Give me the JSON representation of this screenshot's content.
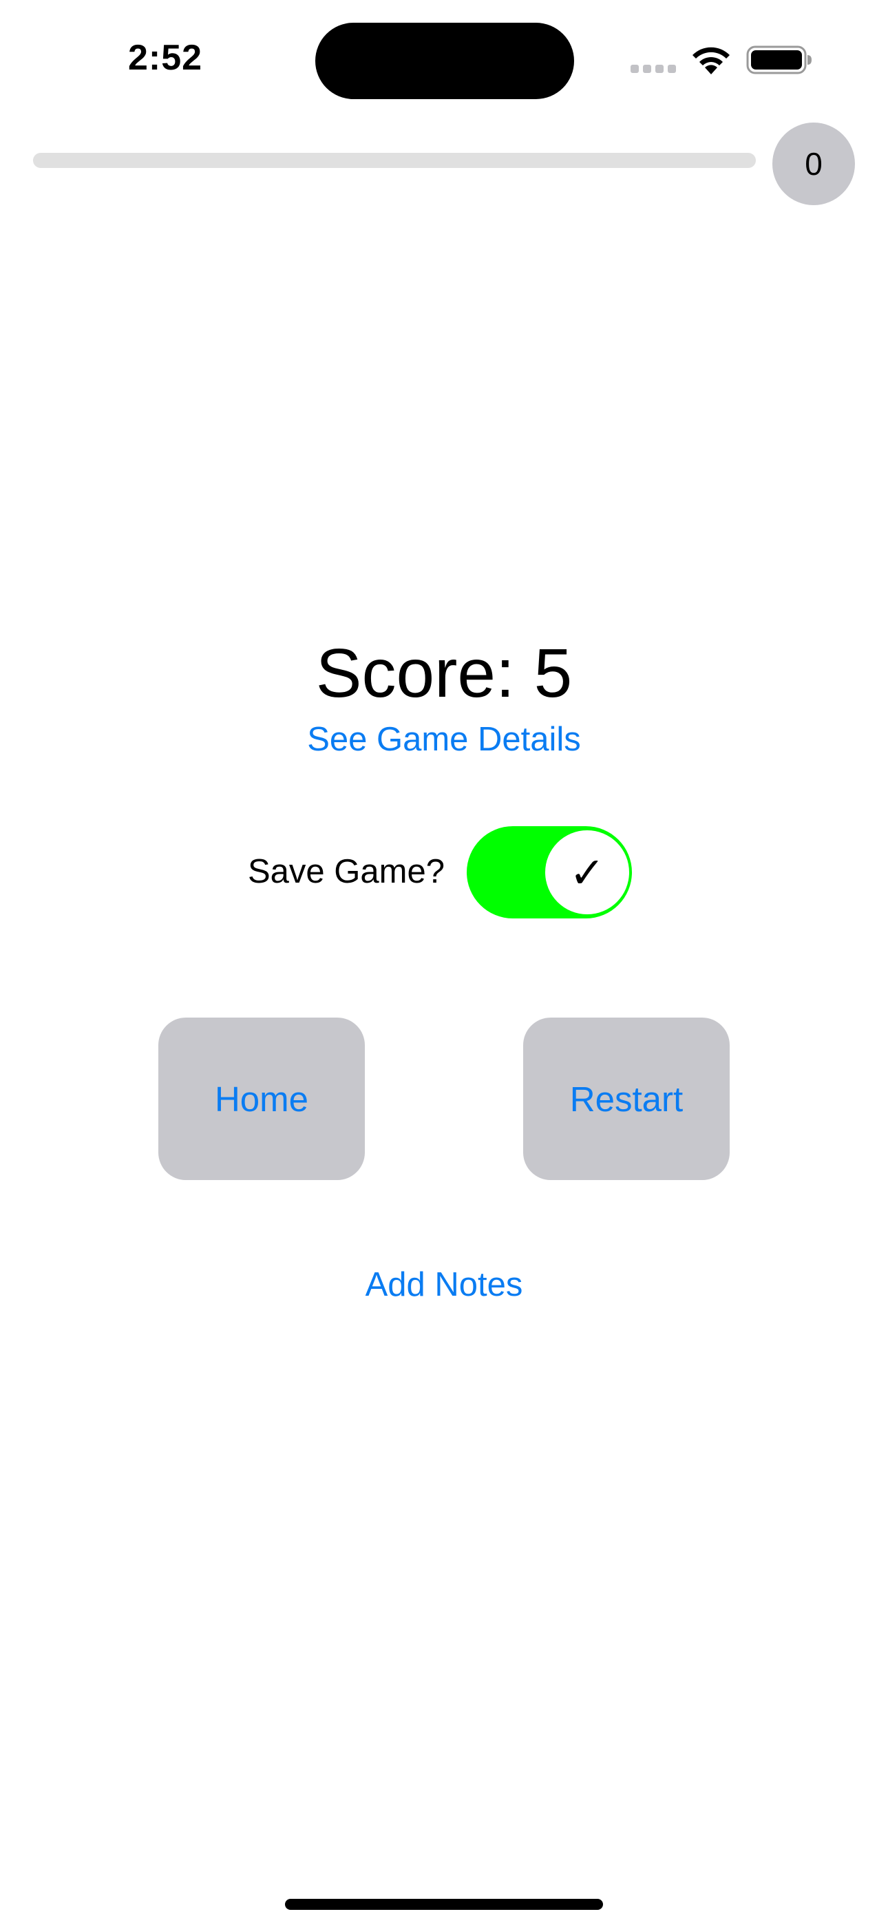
{
  "status_bar": {
    "time": "2:52"
  },
  "progress": {
    "fraction": 0,
    "badge_value": "0"
  },
  "score": {
    "text": "Score: 5"
  },
  "links": {
    "game_details": "See Game Details",
    "add_notes": "Add Notes"
  },
  "save_game": {
    "label": "Save Game?",
    "toggle_on": true,
    "check_glyph": "✓"
  },
  "buttons": {
    "home": "Home",
    "restart": "Restart"
  },
  "colors": {
    "link": "#0a7cf2",
    "toggle_on": "#00ff00",
    "button_bg": "#c7c7cc",
    "progress_track": "#e0e0e0"
  },
  "icons": {
    "wifi": "wifi-icon",
    "battery": "battery-icon",
    "signal": "cellular-signal-icon"
  }
}
